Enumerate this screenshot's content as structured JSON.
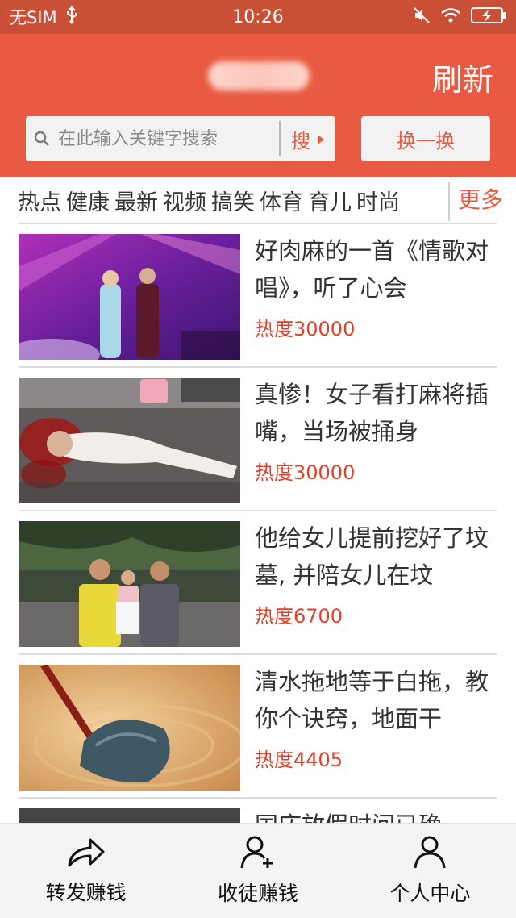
{
  "status_bar": {
    "carrier": "无SIM",
    "time": "10:26"
  },
  "header": {
    "refresh_label": "刷新"
  },
  "search": {
    "placeholder": "在此输入关键字搜索",
    "button_label": "搜",
    "swap_label": "换一换"
  },
  "tabs": {
    "items": [
      "热点",
      "健康",
      "最新",
      "视频",
      "搞笑",
      "体育",
      "育儿",
      "时尚"
    ],
    "more_label": "更多"
  },
  "news": [
    {
      "title": "好肉麻的一首《情歌对唱》，听了心会",
      "heat": "热度30000",
      "thumb": "stage-singers"
    },
    {
      "title": "真惨！女子看打麻将插嘴，当场被捅身",
      "heat": "热度30000",
      "thumb": "accident-scene"
    },
    {
      "title": "他给女儿提前挖好了坟墓, 并陪女儿在坟",
      "heat": "热度6700",
      "thumb": "family-photo"
    },
    {
      "title": "清水拖地等于白拖，教你个诀窍，地面干",
      "heat": "热度4405",
      "thumb": "mop-floor"
    },
    {
      "title": "国庆放假时间已确",
      "heat": "",
      "thumb": "partial"
    }
  ],
  "bottom_nav": {
    "items": [
      {
        "label": "转发赚钱",
        "icon": "share-icon"
      },
      {
        "label": "收徒赚钱",
        "icon": "add-user-icon"
      },
      {
        "label": "个人中心",
        "icon": "user-icon"
      }
    ]
  },
  "colors": {
    "accent": "#e95a42",
    "status_bar": "#c94f36",
    "heat_text": "#e0402b"
  }
}
